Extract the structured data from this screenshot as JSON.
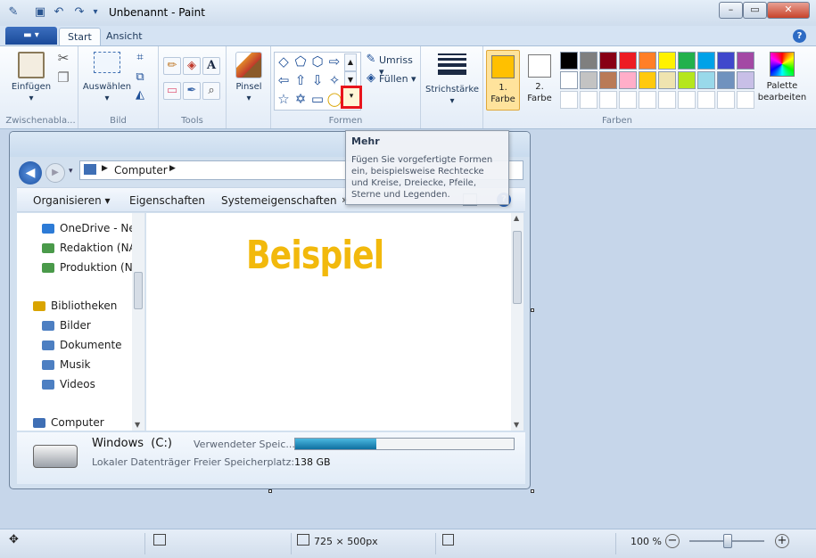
{
  "window": {
    "title": "Unbenannt - Paint"
  },
  "titlebar": {
    "minimize": "–",
    "maximize": "▭",
    "close": "✕",
    "qa_dropdown": "▾"
  },
  "tabs": {
    "file": "▬ ▾",
    "start": "Start",
    "view": "Ansicht"
  },
  "groups": {
    "clipboard": {
      "label": "Zwischenabla...",
      "paste": "Einfügen"
    },
    "image": {
      "label": "Bild",
      "select": "Auswählen"
    },
    "tools": {
      "label": "Tools"
    },
    "brushes": {
      "label": "Pinsel"
    },
    "shapes": {
      "label": "Formen",
      "outline": "Umriss",
      "fill": "Füllen"
    },
    "size": {
      "label": "Strichstärke"
    },
    "colors": {
      "label": "Farben",
      "color1_label": "1. Farbe",
      "color2_label": "2. Farbe",
      "edit_palette": "Palette bearbeiten",
      "color1": "#ffc000",
      "color2": "#ffffff",
      "swatches": [
        "#000000",
        "#7f7f7f",
        "#880015",
        "#ed1c24",
        "#ff7f27",
        "#fff200",
        "#22b14c",
        "#00a2e8",
        "#3f48cc",
        "#a349a4",
        "#ffffff",
        "#c3c3c3",
        "#b97a57",
        "#ffaec9",
        "#ffc90e",
        "#efe4b0",
        "#b5e61d",
        "#99d9ea",
        "#7092be",
        "#c8bfe7"
      ]
    }
  },
  "tooltip": {
    "title": "Mehr",
    "text": "Fügen Sie vorgefertigte Formen ein, beispielsweise Rechtecke und Kreise, Dreiecke, Pfeile, Sterne und Legenden."
  },
  "explorer": {
    "breadcrumb": "Computer",
    "toolbar": {
      "organize": "Organisieren",
      "properties": "Eigenschaften",
      "system": "Systemeigenschaften",
      "more": "»"
    },
    "nav": [
      "OneDrive - Neu",
      "Redaktion (NA:",
      "Produktion (NA",
      "Bibliotheken",
      "Bilder",
      "Dokumente",
      "Musik",
      "Videos",
      "Computer"
    ],
    "drive": {
      "name": "Windows",
      "letter": "(C:)",
      "used_label": "Verwendeter Speic...",
      "type": "Lokaler Datenträger",
      "free_label": "Freier Speicherplatz:",
      "free_value": "138 GB",
      "used_fraction": 0.37
    }
  },
  "canvas_text": "Beispiel",
  "status": {
    "size": "725 × 500px",
    "zoom": "100 %"
  }
}
